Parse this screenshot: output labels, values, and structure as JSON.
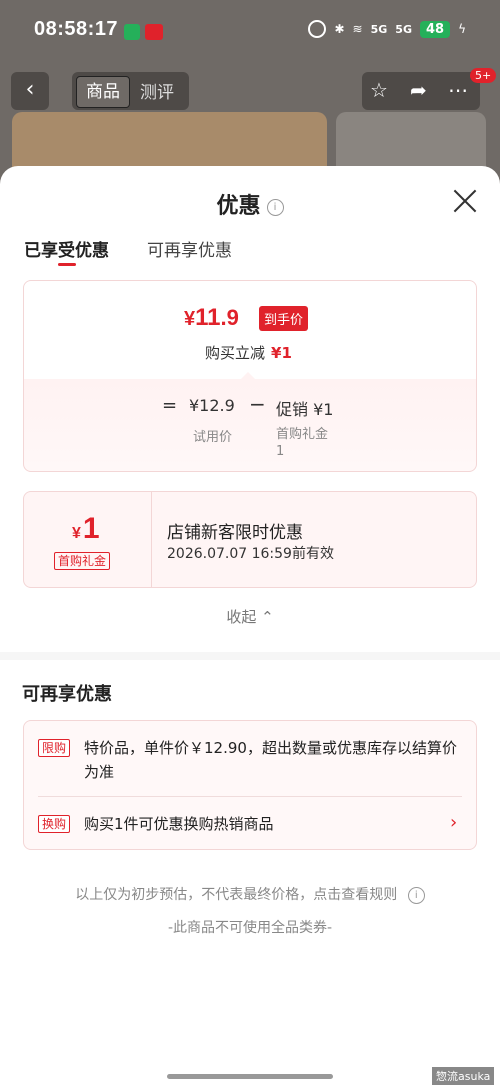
{
  "status_bar": {
    "time": "08:58:17",
    "battery": "48",
    "signal1": "5G",
    "signal2": "5G"
  },
  "nav": {
    "tab_product": "商品",
    "tab_review": "测评",
    "badge": "5+"
  },
  "sheet": {
    "title": "优惠",
    "tabs": [
      {
        "label": "已享受优惠",
        "active": true
      },
      {
        "label": "可再享优惠",
        "active": false
      }
    ]
  },
  "final_price": {
    "currency": "¥",
    "integer": "11",
    "decimal": ".9",
    "tag": "到手价",
    "reduce_label": "购买立减",
    "reduce_amount": "¥1",
    "equals": "=",
    "trial_price": "¥12.9",
    "trial_label": "试用价",
    "minus": "−",
    "promo": "促销 ¥1",
    "promo_detail_line1": "首购礼金",
    "promo_detail_line2": "1"
  },
  "coupon": {
    "currency": "¥",
    "amount": "1",
    "tag": "首购礼金",
    "title": "店铺新客限时优惠",
    "valid_until": "2026.07.07 16:59前有效"
  },
  "collapse_label": "收起",
  "more_offers": {
    "title": "可再享优惠",
    "items": [
      {
        "tag": "限购",
        "text": "特价品，单件价￥12.90，超出数量或优惠库存以结算价为准"
      },
      {
        "tag": "换购",
        "text": "购买1件可优惠换购热销商品"
      }
    ]
  },
  "footnote": "以上仅为初步预估，不代表最终价格，点击查看规则",
  "footnote2": "-此商品不可使用全品类券-",
  "watermark": "惣流asuka",
  "colors": {
    "accent": "#e0222b",
    "overlay": "#6f6a66"
  }
}
